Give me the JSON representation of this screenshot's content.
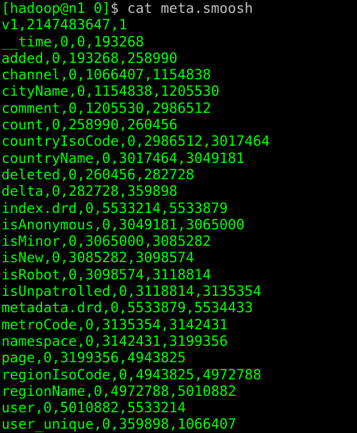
{
  "prompt": {
    "user_host_path": "[hadoop@n1 0]",
    "symbol": "$ ",
    "command": "cat meta.smoosh"
  },
  "lines": [
    "v1,2147483647,1",
    "__time,0,0,193268",
    "added,0,193268,258990",
    "channel,0,1066407,1154838",
    "cityName,0,1154838,1205530",
    "comment,0,1205530,2986512",
    "count,0,258990,260456",
    "countryIsoCode,0,2986512,3017464",
    "countryName,0,3017464,3049181",
    "deleted,0,260456,282728",
    "delta,0,282728,359898",
    "index.drd,0,5533214,5533879",
    "isAnonymous,0,3049181,3065000",
    "isMinor,0,3065000,3085282",
    "isNew,0,3085282,3098574",
    "isRobot,0,3098574,3118814",
    "isUnpatrolled,0,3118814,3135354",
    "metadata.drd,0,5533879,5534433",
    "metroCode,0,3135354,3142431",
    "namespace,0,3142431,3199356",
    "page,0,3199356,4943825",
    "regionIsoCode,0,4943825,4972788",
    "regionName,0,4972788,5010882",
    "user,0,5010882,5533214",
    "user_unique,0,359898,1066407"
  ]
}
